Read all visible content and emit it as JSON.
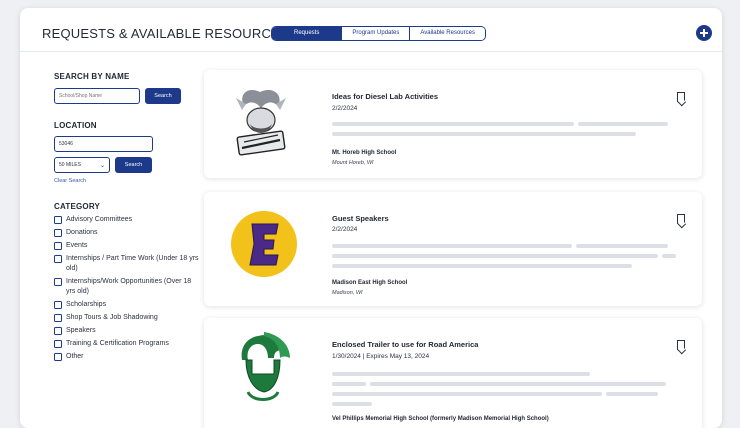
{
  "header": {
    "title": "REQUESTS & AVAILABLE RESOURCES",
    "tabs": [
      {
        "label": "Requests",
        "active": true
      },
      {
        "label": "Program Updates",
        "active": false
      },
      {
        "label": "Available Resources",
        "active": false
      }
    ],
    "add_icon": "plus-circle-icon"
  },
  "sidebar": {
    "search_by_name": {
      "title": "SEARCH BY NAME",
      "placeholder": "School/Shop Name",
      "button": "Search"
    },
    "location": {
      "title": "LOCATION",
      "zip_value": "53046",
      "distance_value": "50 MILES",
      "button": "Search",
      "clear_link": "Clear Search"
    },
    "category": {
      "title": "CATEGORY",
      "items": [
        "Advisory Committees",
        "Donations",
        "Events",
        "Internships / Part Time Work (Under 18 yrs old)",
        "Internships/Work Opportunities (Over 18 yrs old)",
        "Scholarships",
        "Shop Tours & Job Shadowing",
        "Speakers",
        "Training & Certification Programs",
        "Other"
      ]
    }
  },
  "cards": [
    {
      "title": "Ideas for Diesel Lab Activities",
      "date": "2/2/2024",
      "school": "Mt. Horeb High School",
      "location": "Mount Horeb, WI",
      "logo": "vikings-logo"
    },
    {
      "title": "Guest Speakers",
      "date": "2/2/2024",
      "school": "Madison East High School",
      "location": "Madison, WI",
      "logo": "letter-e-logo"
    },
    {
      "title": "Enclosed Trailer to use for Road America",
      "date": "1/30/2024 | Expires May 13, 2024",
      "school": "Vel Phillips Memorial High School (formerly Madison Memorial High School)",
      "location": "",
      "logo": "spartan-logo"
    }
  ],
  "colors": {
    "brand": "#1d3a8a",
    "skeleton": "#dcdfe5",
    "logo_e_yellow": "#f2c21a",
    "logo_e_purple": "#4a2a86",
    "logo_spartan_green": "#1e7a3c"
  }
}
